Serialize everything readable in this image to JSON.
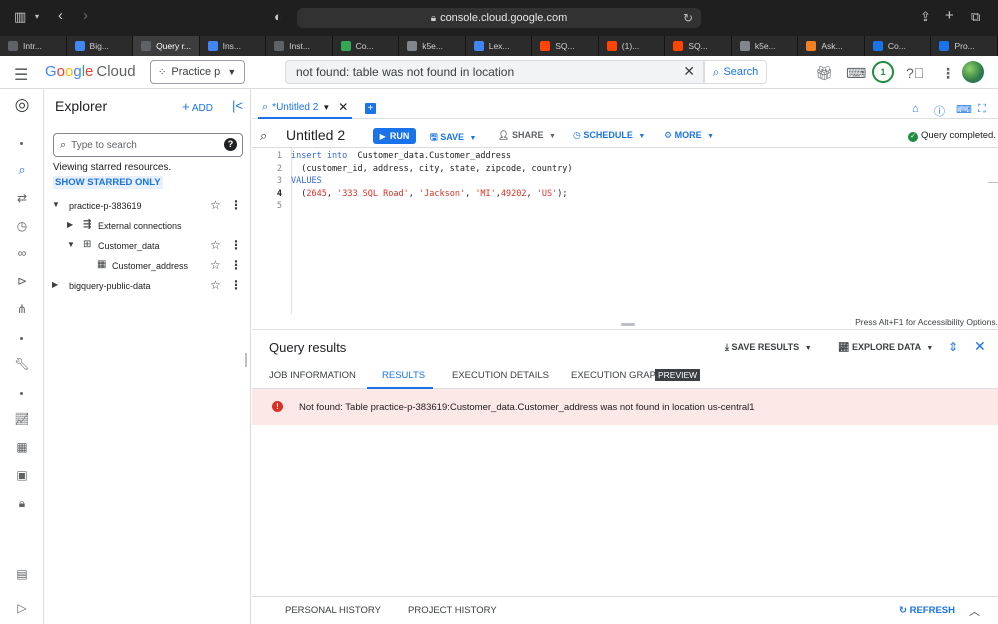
{
  "browser": {
    "url": "console.cloud.google.com",
    "tabs": [
      {
        "label": "Intr...",
        "icon": "generic-favicon",
        "color": "#5f6368"
      },
      {
        "label": "Big...",
        "icon": "google-cloud-favicon",
        "color": "#4285f4"
      },
      {
        "label": "Query r...",
        "icon": "generic-favicon",
        "color": "#5f6368"
      },
      {
        "label": "Ins...",
        "icon": "google-cloud-favicon",
        "color": "#4285f4"
      },
      {
        "label": "Inst...",
        "icon": "generic-favicon",
        "color": "#5f6368"
      },
      {
        "label": "Co...",
        "icon": "generic-favicon",
        "color": "#34a853"
      },
      {
        "label": "k5e...",
        "icon": "r-favicon",
        "color": "#80868b"
      },
      {
        "label": "Lex...",
        "icon": "google-cloud-favicon",
        "color": "#4285f4"
      },
      {
        "label": "SQ...",
        "icon": "reddit-favicon",
        "color": "#ff4500"
      },
      {
        "label": "(1)...",
        "icon": "reddit-favicon",
        "color": "#ff4500"
      },
      {
        "label": "SQ...",
        "icon": "reddit-favicon",
        "color": "#ff4500"
      },
      {
        "label": "k5e...",
        "icon": "r-favicon",
        "color": "#80868b"
      },
      {
        "label": "Ask...",
        "icon": "stackoverflow-favicon",
        "color": "#f48024"
      },
      {
        "label": "Co...",
        "icon": "c-favicon",
        "color": "#1a73e8"
      },
      {
        "label": "Pro...",
        "icon": "c-favicon",
        "color": "#1a73e8"
      }
    ],
    "active_tab_index": 2
  },
  "header": {
    "logo_parts": [
      "G",
      "o",
      "o",
      "g",
      "l",
      "e"
    ],
    "logo_cloud": "Cloud",
    "project": "Practice p",
    "search_value": "not found: table was not found in location",
    "search_button": "Search",
    "notification_count": "1"
  },
  "explorer": {
    "title": "Explorer",
    "add_label": "ADD",
    "search_placeholder": "Type to search",
    "viewing_text": "Viewing starred resources.",
    "show_starred": "SHOW STARRED ONLY",
    "tree": {
      "project": "practice-p-383619",
      "external": "External connections",
      "dataset": "Customer_data",
      "table": "Customer_address",
      "public": "bigquery-public-data"
    }
  },
  "editor": {
    "tab_label": "*Untitled 2",
    "title": "Untitled 2",
    "run": "RUN",
    "save": "SAVE",
    "share": "SHARE",
    "schedule": "SCHEDULE",
    "more": "MORE",
    "status": "Query completed.",
    "line_numbers": [
      "1",
      "2",
      "3",
      "4",
      "5"
    ],
    "code": {
      "l1_kw": "insert into",
      "l1_rest": "  Customer_data.Customer_address",
      "l2": "  (customer_id, address, city, state, zipcode, country)",
      "l3_kw": "VALUES",
      "l4_open": "  (",
      "l4_v1": "2645",
      "l4_v2": "'333 SQL Road'",
      "l4_v3": "'Jackson'",
      "l4_v4": "'MI'",
      "l4_v5": "49202",
      "l4_v6": "'US'",
      "l4_close": ");"
    },
    "accessibility_hint": "Press Alt+F1 for Accessibility Options."
  },
  "results": {
    "title": "Query results",
    "save_results": "SAVE RESULTS",
    "explore_data": "EXPLORE DATA",
    "tabs": [
      "JOB INFORMATION",
      "RESULTS",
      "EXECUTION DETAILS",
      "EXECUTION GRAPH"
    ],
    "preview_badge": "PREVIEW",
    "active_tab": "RESULTS",
    "error": "Not found: Table practice-p-383619:Customer_data.Customer_address was not found in location us-central1"
  },
  "history": {
    "personal": "PERSONAL HISTORY",
    "project": "PROJECT HISTORY",
    "refresh": "REFRESH"
  }
}
